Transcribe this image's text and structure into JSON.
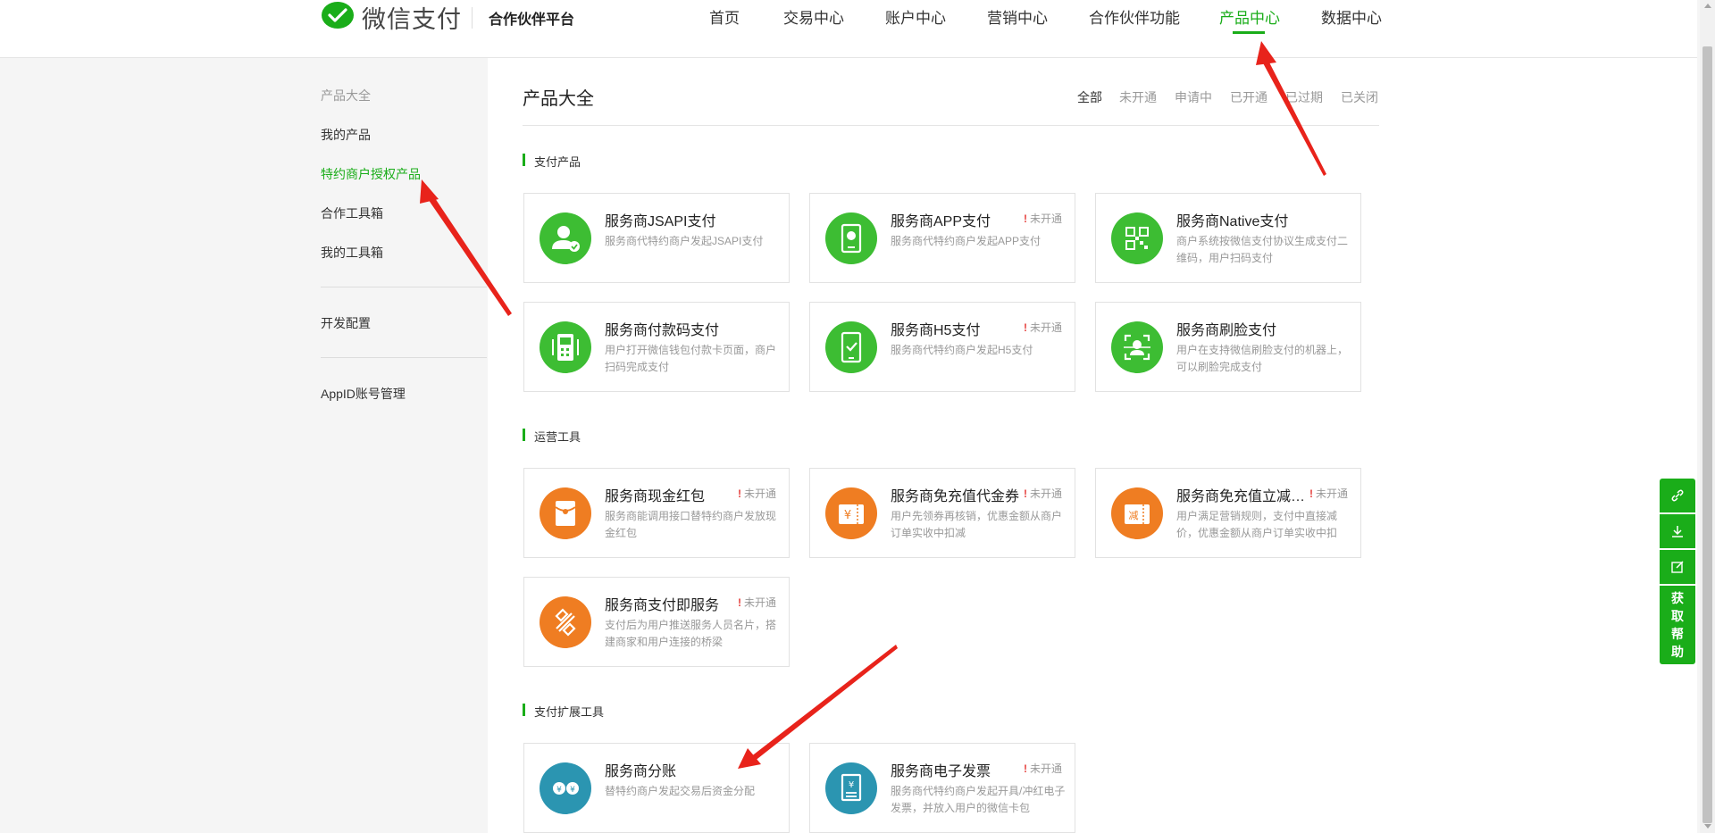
{
  "header": {
    "logo_text": "微信支付",
    "platform": "合作伙伴平台",
    "nav": [
      {
        "label": "首页"
      },
      {
        "label": "交易中心"
      },
      {
        "label": "账户中心"
      },
      {
        "label": "营销中心"
      },
      {
        "label": "合作伙伴功能"
      },
      {
        "label": "产品中心",
        "active": true
      },
      {
        "label": "数据中心"
      }
    ]
  },
  "sidebar": {
    "heading": "产品大全",
    "items": [
      {
        "label": "我的产品"
      },
      {
        "label": "特约商户授权产品",
        "active": true
      },
      {
        "label": "合作工具箱"
      },
      {
        "label": "我的工具箱"
      },
      {
        "label": "开发配置"
      },
      {
        "label": "AppID账号管理"
      }
    ]
  },
  "main": {
    "title": "产品大全",
    "filters": [
      {
        "label": "全部",
        "active": true
      },
      {
        "label": "未开通"
      },
      {
        "label": "申请中"
      },
      {
        "label": "已开通"
      },
      {
        "label": "已过期"
      },
      {
        "label": "已关闭"
      }
    ],
    "sections": [
      {
        "title": "支付产品",
        "cards": [
          {
            "title": "服务商JSAPI支付",
            "desc": "服务商代特约商户发起JSAPI支付",
            "status": "",
            "icon": "person-check-icon",
            "color": "#3dbd33"
          },
          {
            "title": "服务商APP支付",
            "desc": "服务商代特约商户发起APP支付",
            "status": "未开通",
            "icon": "phone-app-icon",
            "color": "#3dbd33"
          },
          {
            "title": "服务商Native支付",
            "desc": "商户系统按微信支付协议生成支付二维码，用户扫码支付",
            "status": "",
            "icon": "qrcode-icon",
            "color": "#3dbd33"
          },
          {
            "title": "服务商付款码支付",
            "desc": "用户打开微信钱包付款卡页面，商户扫码完成支付",
            "status": "",
            "icon": "pos-terminal-icon",
            "color": "#3dbd33"
          },
          {
            "title": "服务商H5支付",
            "desc": "服务商代特约商户发起H5支付",
            "status": "未开通",
            "icon": "mobile-check-icon",
            "color": "#3dbd33"
          },
          {
            "title": "服务商刷脸支付",
            "desc": "用户在支持微信刷脸支付的机器上，可以刷脸完成支付",
            "status": "",
            "icon": "face-scan-icon",
            "color": "#3dbd33"
          }
        ]
      },
      {
        "title": "运营工具",
        "cards": [
          {
            "title": "服务商现金红包",
            "desc": "服务商能调用接口替特约商户发放现金红包",
            "status": "未开通",
            "icon": "red-packet-icon",
            "color": "#ef7d22"
          },
          {
            "title": "服务商免充值代金券",
            "desc": "用户先领券再核销，优惠金额从商户订单实收中扣减",
            "status": "未开通",
            "icon": "coupon-yuan-icon",
            "color": "#ef7d22"
          },
          {
            "title": "服务商免充值立减与折扣",
            "desc": "用户满足营销规则，支付中直接减价，优惠金额从商户订单实收中扣",
            "status": "未开通",
            "icon": "discount-coupon-icon",
            "color": "#ef7d22"
          },
          {
            "title": "服务商支付即服务",
            "desc": "支付后为用户推送服务人员名片，搭建商家和用户连接的桥梁",
            "status": "未开通",
            "icon": "link-connect-icon",
            "color": "#ef7d22"
          }
        ]
      },
      {
        "title": "支付扩展工具",
        "cards": [
          {
            "title": "服务商分账",
            "desc": "替特约商户发起交易后资金分配",
            "status": "",
            "icon": "split-funds-icon",
            "color": "#2b95b1"
          },
          {
            "title": "服务商电子发票",
            "desc": "服务商代特约商户发起开具/冲红电子发票，并放入用户的微信卡包",
            "status": "未开通",
            "icon": "invoice-icon",
            "color": "#2b95b1"
          }
        ]
      }
    ]
  },
  "float_tools": {
    "help_label": [
      "获",
      "取",
      "帮",
      "助"
    ]
  }
}
